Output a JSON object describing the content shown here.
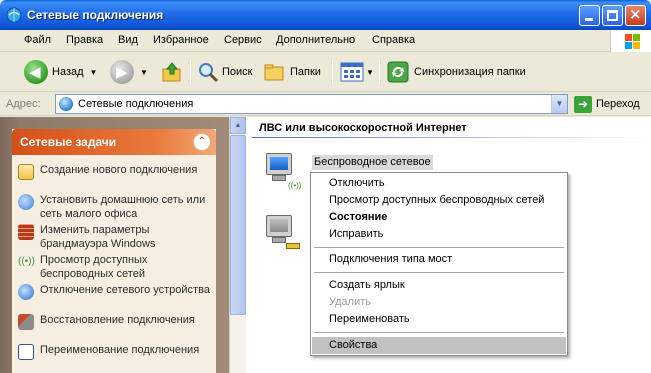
{
  "window": {
    "title": "Сетевые подключения",
    "buttons": {
      "minimize": "minimize",
      "maximize": "maximize",
      "close": "×"
    }
  },
  "menubar": [
    "Файл",
    "Правка",
    "Вид",
    "Избранное",
    "Сервис",
    "Дополнительно",
    "Справка"
  ],
  "toolbar": {
    "back_label": "Назад",
    "search_label": "Поиск",
    "folders_label": "Папки",
    "sync_label": "Синхронизация папки"
  },
  "address": {
    "label": "Адрес:",
    "value": "Сетевые подключения",
    "go_label": "Переход"
  },
  "taskpane": {
    "title": "Сетевые задачи",
    "collapse_glyph": "⌃",
    "items": [
      {
        "label": "Создание нового подключения",
        "icon": "new-connection-icon"
      },
      {
        "label": "Установить домашнюю сеть или сеть малого офиса",
        "icon": "home-network-icon"
      },
      {
        "label": "Изменить параметры брандмауэра Windows",
        "icon": "firewall-icon"
      },
      {
        "label": "Просмотр доступных беспроводных сетей",
        "icon": "wireless-icon"
      },
      {
        "label": "Отключение сетевого устройства",
        "icon": "disable-device-icon"
      },
      {
        "label": "Восстановление подключения",
        "icon": "repair-icon"
      },
      {
        "label": "Переименование подключения",
        "icon": "rename-icon"
      }
    ]
  },
  "content": {
    "group_title": "ЛВС или высокоскоростной Интернет",
    "connections": [
      {
        "label": "Беспроводное сетевое",
        "icon": "wireless-connection-icon"
      },
      {
        "label": "",
        "icon": "lan-connection-icon"
      }
    ]
  },
  "context_menu": {
    "items": [
      {
        "label": "Отключить",
        "style": "normal"
      },
      {
        "label": "Просмотр доступных беспроводных сетей",
        "style": "normal"
      },
      {
        "label": "Состояние",
        "style": "bold"
      },
      {
        "label": "Исправить",
        "style": "normal"
      },
      {
        "label": "Подключения типа мост",
        "style": "normal"
      },
      {
        "label": "Создать ярлык",
        "style": "normal"
      },
      {
        "label": "Удалить",
        "style": "disabled"
      },
      {
        "label": "Переименовать",
        "style": "normal"
      },
      {
        "label": "Свойства",
        "style": "hover"
      }
    ]
  },
  "colors": {
    "titlebar": "#1f6cea",
    "task_header": "#d6501a",
    "menu_hover": "#c1c1c1"
  }
}
